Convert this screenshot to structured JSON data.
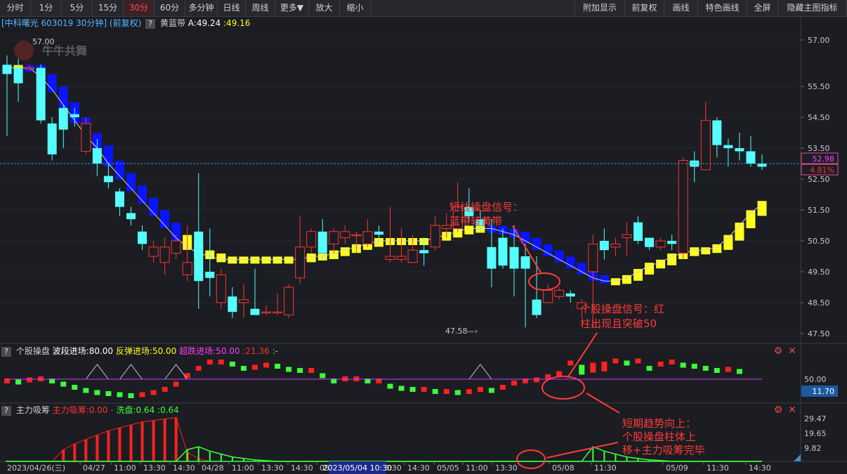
{
  "toolbar": {
    "left": [
      "分时",
      "1分",
      "5分",
      "15分",
      "30分",
      "60分",
      "多分钟",
      "日线",
      "周线",
      "更多▼",
      "放大",
      "缩小"
    ],
    "active_index": 4,
    "right": [
      "附加显示",
      "前复权",
      "画线",
      "特色画线",
      "全屏",
      "隐藏主图指标"
    ]
  },
  "main": {
    "stock_label": "[中科曙光 603019 30分钟]",
    "adjust_label": "(前复权)",
    "q": "?",
    "indicator_name": "黄蓝带",
    "indicator_a": "A:49.24",
    "indicator_b": ":49.16",
    "watermark": "牛牛共舞",
    "high_marker": "57.00",
    "low_marker": "47.58",
    "price_label": "52.98",
    "pct_label": "4.81%",
    "y_ticks": [
      "57.00",
      "55.50",
      "54.50",
      "53.50",
      "52.50",
      "51.50",
      "50.50",
      "49.50",
      "48.50",
      "47.50"
    ],
    "annotation1": [
      "短线操盘信号：",
      "蓝带转黄带"
    ],
    "annotation2": [
      "个股操盘信号：红",
      "柱出现且突破50"
    ],
    "annotation3": [
      "短期趋势向上：",
      "个股操盘柱体上",
      "移+主力吸筹完毕"
    ]
  },
  "panel1": {
    "q": "?",
    "name": "个股操盘",
    "l1": "波段进场:80.00",
    "l2": "反弹进场:50.00",
    "l3": "超跌进场:50.00",
    "l4": ":21.36",
    "l5": ":-",
    "tick_50": "50.00",
    "value_box": "11.70"
  },
  "panel2": {
    "q": "?",
    "name": "主力吸筹",
    "l1": "主力吸筹:0.00",
    "l2": "-",
    "l3": "洗盘:0.64",
    "l4": ":0.64",
    "y_ticks": [
      "29.47",
      "19.65",
      "9.82"
    ]
  },
  "x_axis": {
    "labels": [
      "2023/04/26(三)",
      "04/27",
      "11:00",
      "13:30",
      "14:30",
      "04/28",
      "11:00",
      "13:30",
      "14:30",
      "05",
      "11:00",
      "13:30",
      "14:30",
      "05/05",
      "11:00",
      "13:30",
      "05/08",
      "11:30",
      "05/09",
      "11:30",
      "14:30"
    ],
    "cursor_label": "2023/05/04 10:30"
  },
  "colors": {
    "up": "#ff3232",
    "down": "#54ffff",
    "blue_band": "#0a14ff",
    "yellow_band": "#ffff1e",
    "annotation": "#ff3a3a",
    "accent_purple": "#ff40ff",
    "green": "#3cff3c"
  },
  "chart_data": {
    "type": "candlestick",
    "ylim": [
      47.2,
      57.4
    ],
    "candles": [
      [
        56.2,
        55.9,
        56.5,
        53.9
      ],
      [
        56.1,
        55.6,
        56.4,
        55.0
      ],
      [
        56.1,
        56.1,
        56.2,
        56.0
      ],
      [
        56.1,
        54.4,
        56.2,
        54.3
      ],
      [
        54.3,
        53.3,
        54.5,
        53.1
      ],
      [
        54.8,
        54.1,
        54.9,
        53.5
      ],
      [
        54.6,
        54.5,
        54.8,
        54.2
      ],
      [
        53.4,
        54.3,
        54.5,
        53.3
      ],
      [
        53.5,
        53.0,
        53.8,
        52.6
      ],
      [
        52.6,
        52.4,
        53.0,
        52.2
      ],
      [
        52.1,
        51.6,
        52.2,
        51.3
      ],
      [
        51.4,
        51.2,
        51.6,
        51.0
      ],
      [
        50.8,
        50.4,
        51.0,
        50.2
      ],
      [
        50.0,
        50.3,
        50.5,
        49.8
      ],
      [
        49.8,
        50.3,
        50.6,
        49.4
      ],
      [
        50.1,
        50.5,
        50.7,
        49.9
      ],
      [
        49.4,
        49.8,
        51.0,
        49.2
      ],
      [
        50.8,
        49.2,
        52.7,
        48.3
      ],
      [
        49.5,
        49.3,
        50.9,
        48.7
      ],
      [
        48.5,
        49.4,
        49.6,
        48.3
      ],
      [
        48.7,
        48.2,
        49.0,
        48.0
      ],
      [
        48.5,
        48.6,
        49.1,
        48.0
      ],
      [
        48.3,
        48.1,
        49.6,
        48.1
      ],
      [
        48.2,
        48.2,
        48.4,
        48.1
      ],
      [
        48.2,
        48.2,
        48.8,
        48.1
      ],
      [
        48.1,
        49.0,
        49.1,
        48.0
      ],
      [
        49.3,
        50.3,
        51.3,
        49.1
      ],
      [
        50.3,
        50.8,
        50.9,
        50.1
      ],
      [
        50.8,
        50.1,
        51.2,
        49.9
      ],
      [
        50.4,
        50.8,
        50.9,
        50.1
      ],
      [
        50.6,
        50.8,
        51.0,
        50.4
      ],
      [
        50.7,
        50.7,
        50.8,
        50.1
      ],
      [
        50.4,
        50.8,
        51.2,
        50.3
      ],
      [
        50.8,
        50.7,
        51.0,
        50.4
      ],
      [
        49.9,
        50.0,
        51.6,
        49.8
      ],
      [
        49.9,
        50.0,
        50.9,
        49.8
      ],
      [
        49.8,
        50.2,
        50.7,
        49.9
      ],
      [
        50.2,
        50.1,
        50.6,
        49.7
      ],
      [
        50.3,
        51.0,
        51.3,
        50.2
      ],
      [
        50.9,
        51.0,
        51.4,
        50.6
      ],
      [
        50.9,
        51.6,
        52.4,
        50.8
      ],
      [
        51.6,
        51.3,
        52.2,
        51.1
      ],
      [
        51.2,
        51.0,
        51.5,
        50.8
      ],
      [
        50.3,
        49.6,
        51.2,
        49.0
      ],
      [
        50.6,
        49.7,
        50.9,
        49.6
      ],
      [
        50.3,
        49.6,
        51.0,
        48.7
      ],
      [
        50.0,
        49.6,
        50.4,
        47.7
      ],
      [
        48.6,
        48.1,
        50.0,
        48.0
      ],
      [
        48.5,
        48.9,
        49.1,
        48.5
      ],
      [
        48.7,
        48.9,
        49.0,
        48.6
      ],
      [
        48.8,
        48.7,
        48.9,
        48.5
      ],
      [
        48.3,
        48.5,
        48.6,
        48.0
      ],
      [
        49.5,
        50.4,
        50.7,
        47.7
      ],
      [
        50.5,
        50.2,
        50.9,
        49.9
      ],
      [
        50.3,
        50.4,
        50.6,
        50.0
      ],
      [
        50.6,
        50.7,
        51.1,
        50.0
      ],
      [
        51.1,
        50.5,
        51.3,
        50.4
      ],
      [
        50.6,
        50.3,
        50.6,
        50.2
      ],
      [
        50.3,
        50.5,
        50.6,
        50.2
      ],
      [
        50.5,
        50.4,
        50.7,
        50.2
      ],
      [
        50.1,
        53.1,
        53.2,
        49.9
      ],
      [
        53.1,
        52.9,
        53.4,
        52.4
      ],
      [
        52.8,
        54.4,
        55.0,
        52.8
      ],
      [
        54.4,
        53.6,
        54.5,
        53.2
      ],
      [
        53.6,
        53.5,
        53.8,
        52.9
      ],
      [
        53.5,
        53.4,
        54.0,
        53.1
      ],
      [
        53.4,
        53.0,
        53.9,
        52.9
      ],
      [
        53.0,
        52.9,
        53.3,
        52.8
      ]
    ],
    "band": [
      56.1,
      56.1,
      56.1,
      55.8,
      55.4,
      54.9,
      54.4,
      53.9,
      53.5,
      53.0,
      52.6,
      52.2,
      51.8,
      51.4,
      51.0,
      50.6,
      50.3,
      50.1,
      50.0,
      49.9,
      49.9,
      49.9,
      49.9,
      49.9,
      49.9,
      49.9,
      49.9,
      50.0,
      50.0,
      50.1,
      50.2,
      50.3,
      50.4,
      50.5,
      50.5,
      50.5,
      50.5,
      50.5,
      50.6,
      50.7,
      50.8,
      50.9,
      50.9,
      50.9,
      50.8,
      50.7,
      50.5,
      50.3,
      50.1,
      49.9,
      49.7,
      49.5,
      49.3,
      49.2,
      49.2,
      49.3,
      49.5,
      49.7,
      49.8,
      50.0,
      50.1,
      50.2,
      50.2,
      50.3,
      50.6,
      51.0,
      51.4,
      51.7,
      52.0,
      52.3,
      52.5,
      52.6
    ],
    "band_color": [
      "b",
      "y",
      "b",
      "b",
      "b",
      "b",
      "b",
      "b",
      "b",
      "b",
      "b",
      "b",
      "b",
      "b",
      "b",
      "b",
      "y",
      "y",
      "y",
      "y",
      "y",
      "y",
      "y",
      "y",
      "y",
      "y",
      "y",
      "y",
      "y",
      "y",
      "y",
      "y",
      "y",
      "y",
      "y",
      "y",
      "y",
      "y",
      "y",
      "y",
      "y",
      "y",
      "y",
      "b",
      "b",
      "b",
      "b",
      "b",
      "b",
      "b",
      "b",
      "b",
      "b",
      "b",
      "y",
      "y",
      "y",
      "y",
      "y",
      "y",
      "y",
      "y",
      "y",
      "y",
      "y",
      "y",
      "y",
      "y",
      "y",
      "y",
      "y",
      "y"
    ],
    "osc": [
      48,
      47,
      49,
      50,
      48,
      45,
      42,
      39,
      37,
      36,
      35,
      34,
      35,
      37,
      40,
      45,
      53,
      60,
      66,
      66,
      64,
      60,
      61,
      63,
      62,
      59,
      58,
      58,
      53,
      48,
      50,
      50,
      48,
      48,
      43,
      41,
      40,
      40,
      38,
      38,
      37,
      38,
      40,
      39,
      42,
      46,
      48,
      49,
      52,
      55,
      65,
      61,
      63,
      64,
      67,
      65,
      67,
      60,
      64,
      66,
      63,
      62,
      60,
      58,
      59,
      57
    ],
    "accum": [
      0,
      0,
      0,
      0,
      0,
      8,
      12,
      15,
      18,
      21,
      23,
      25,
      27,
      28,
      29,
      30,
      6,
      2,
      0,
      0,
      0,
      0,
      0,
      0,
      0,
      0,
      0,
      0,
      0,
      0,
      0,
      0,
      0,
      0,
      0,
      0,
      0,
      0,
      0,
      0,
      0,
      0,
      0,
      0,
      0,
      0,
      0,
      0,
      0,
      0,
      0,
      0,
      0,
      0,
      0,
      0,
      0,
      0,
      0,
      0,
      0,
      0,
      0,
      0,
      0,
      0,
      0,
      0
    ],
    "wash": [
      0,
      0,
      0,
      0,
      0,
      0,
      0,
      0,
      0,
      0,
      0,
      0,
      0,
      0,
      0,
      0,
      8,
      10,
      7,
      5,
      3,
      2,
      1,
      0.5,
      0,
      0,
      0,
      0,
      0,
      0,
      0,
      0,
      0,
      0,
      0,
      0,
      0,
      0,
      0,
      0,
      0,
      0,
      0,
      0,
      0,
      0,
      0,
      0,
      0,
      0,
      0,
      0,
      10,
      7,
      5,
      3,
      2,
      1,
      0.6,
      0,
      0,
      0,
      0,
      0,
      0,
      0,
      0,
      0
    ]
  }
}
